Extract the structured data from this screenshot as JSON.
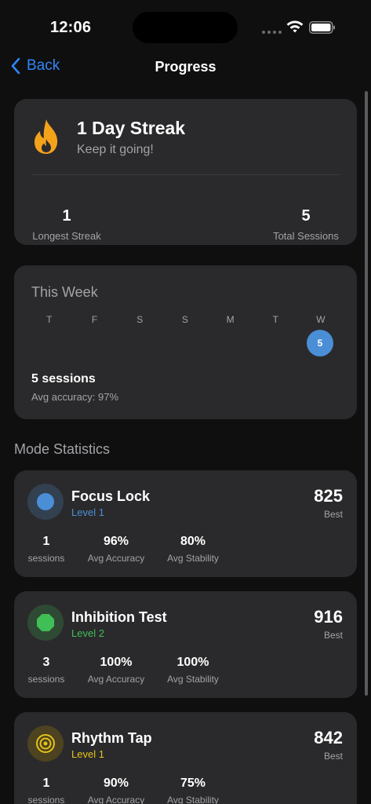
{
  "status_bar": {
    "time": "12:06"
  },
  "nav": {
    "back_label": "Back",
    "title": "Progress"
  },
  "streak": {
    "title": "1 Day Streak",
    "subtitle": "Keep it going!",
    "longest_value": "1",
    "longest_label": "Longest Streak",
    "total_value": "5",
    "total_label": "Total Sessions"
  },
  "week": {
    "title": "This Week",
    "days": [
      "T",
      "F",
      "S",
      "S",
      "M",
      "T",
      "W"
    ],
    "today_count": "5",
    "sessions": "5 sessions",
    "avg_accuracy": "Avg accuracy: 97%"
  },
  "section_title": "Mode Statistics",
  "modes": [
    {
      "name": "Focus Lock",
      "level": "Level 1",
      "best": "825",
      "best_label": "Best",
      "sessions": "1",
      "sessions_label": "sessions",
      "accuracy": "96%",
      "accuracy_label": "Avg Accuracy",
      "stability": "80%",
      "stability_label": "Avg Stability",
      "accent": "#4a8fd6",
      "icon": "circle-icon"
    },
    {
      "name": "Inhibition Test",
      "level": "Level 2",
      "best": "916",
      "best_label": "Best",
      "sessions": "3",
      "sessions_label": "sessions",
      "accuracy": "100%",
      "accuracy_label": "Avg Accuracy",
      "stability": "100%",
      "stability_label": "Avg Stability",
      "accent": "#3fbf55",
      "icon": "octagon-icon"
    },
    {
      "name": "Rhythm Tap",
      "level": "Level 1",
      "best": "842",
      "best_label": "Best",
      "sessions": "1",
      "sessions_label": "sessions",
      "accuracy": "90%",
      "accuracy_label": "Avg Accuracy",
      "stability": "75%",
      "stability_label": "Avg Stability",
      "accent": "#e6c21a",
      "icon": "target-icon"
    }
  ],
  "colors": {
    "background": "#0f0f10",
    "card": "#2a2a2c",
    "link": "#2f86f6",
    "streak": "#f5a21b"
  }
}
